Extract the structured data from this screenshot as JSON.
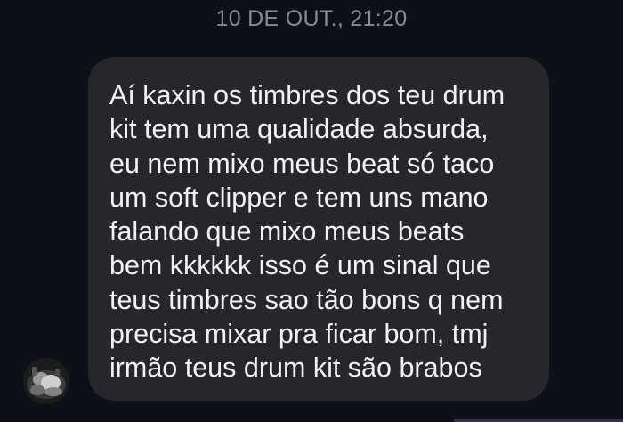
{
  "chat": {
    "timestamp": "10 DE OUT., 21:20",
    "messages": [
      {
        "sender_avatar": "contact-avatar",
        "text": "Aí kaxin os timbres dos teu drum\nkit tem uma qualidade absurda,\neu nem mixo meus beat só taco\num soft clipper e tem uns mano\nfalando que mixo meus beats\nbem kkkkkk isso é um sinal que\nteus timbres sao tão bons q nem\nprecisa mixar pra ficar bom, tmj\nirmão teus drum kit são brabos"
      }
    ]
  },
  "colors": {
    "background": "#0e1017",
    "bubble": "#26272c",
    "text": "#f2f2f4",
    "timestamp": "#8a8b92"
  }
}
